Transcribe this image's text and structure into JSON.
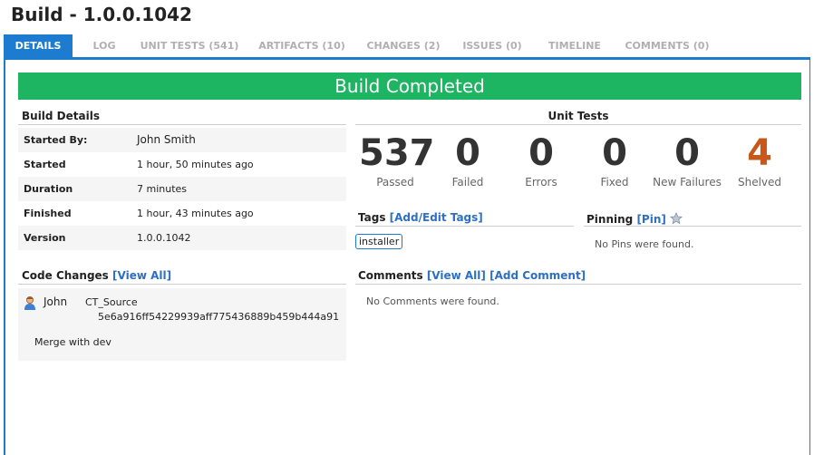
{
  "page": {
    "title": "Build - 1.0.0.1042"
  },
  "tabs": [
    "DETAILS",
    "LOG",
    "UNIT TESTS (541)",
    "ARTIFACTS (10)",
    "CHANGES (2)",
    "ISSUES (0)",
    "TIMELINE",
    "COMMENTS (0)"
  ],
  "banner": {
    "text": "Build Completed",
    "color": "#1db462"
  },
  "build_details": {
    "heading": "Build Details",
    "rows": [
      {
        "label": "Started By:",
        "value": "John Smith"
      },
      {
        "label": "Started",
        "value": "1 hour, 50 minutes ago"
      },
      {
        "label": "Duration",
        "value": "7 minutes"
      },
      {
        "label": "Finished",
        "value": "1 hour, 43 minutes ago"
      },
      {
        "label": "Version",
        "value": "1.0.0.1042"
      }
    ]
  },
  "code_changes": {
    "heading": "Code Changes",
    "view_all": "[View All]",
    "items": [
      {
        "author": "John",
        "repository": "CT_Source",
        "commit": "5e6a916ff54229939aff775436889b459b444a91",
        "message": "Merge with dev"
      }
    ]
  },
  "unit_tests": {
    "heading": "Unit Tests",
    "stats": [
      {
        "value": "537",
        "label": "Passed"
      },
      {
        "value": "0",
        "label": "Failed"
      },
      {
        "value": "0",
        "label": "Errors"
      },
      {
        "value": "0",
        "label": "Fixed"
      },
      {
        "value": "0",
        "label": "New Failures"
      },
      {
        "value": "4",
        "label": "Shelved",
        "color": "#c8571a"
      }
    ]
  },
  "tags": {
    "heading": "Tags",
    "add_edit": "[Add/Edit Tags]",
    "items": [
      "installer"
    ]
  },
  "pinning": {
    "heading": "Pinning",
    "pin": "[Pin]",
    "empty": "No Pins were found."
  },
  "comments": {
    "heading": "Comments",
    "view_all": "[View All]",
    "add": "[Add Comment]",
    "empty": "No Comments were found."
  }
}
